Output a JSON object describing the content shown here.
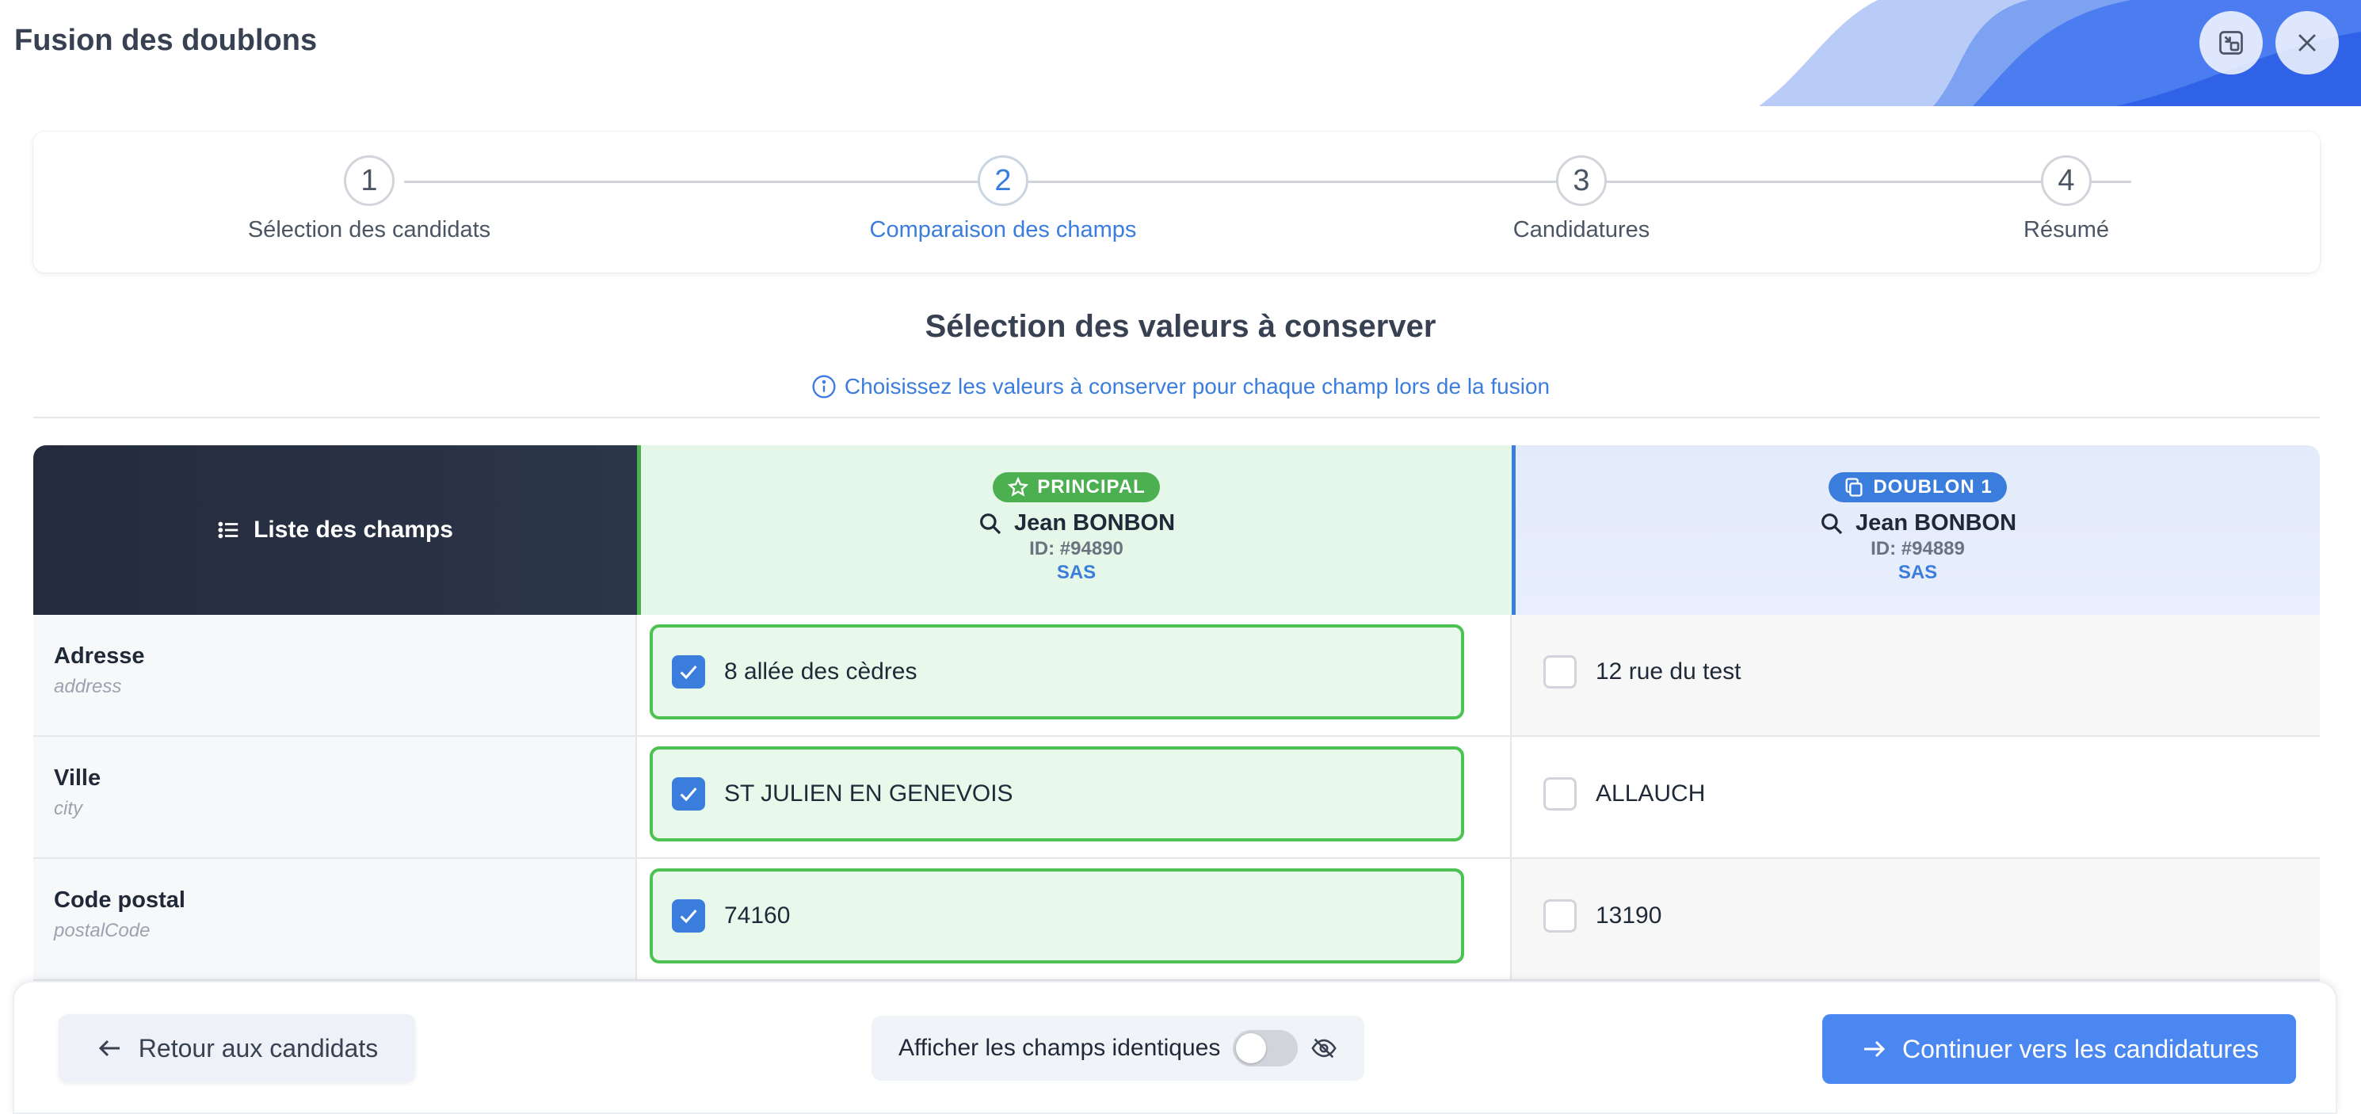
{
  "window": {
    "title": "Fusion des doublons"
  },
  "stepper": {
    "steps": [
      {
        "number": "1",
        "label": "Sélection des candidats"
      },
      {
        "number": "2",
        "label": "Comparaison des champs"
      },
      {
        "number": "3",
        "label": "Candidatures"
      },
      {
        "number": "4",
        "label": "Résumé"
      }
    ],
    "active_step": 2
  },
  "section": {
    "title": "Sélection des valeurs à conserver",
    "hint": "Choisissez les valeurs à conserver pour chaque champ lors de la fusion"
  },
  "table": {
    "fields_header": "Liste des champs",
    "principal": {
      "badge": "PRINCIPAL",
      "name": "Jean BONBON",
      "id": "ID: #94890",
      "company": "SAS"
    },
    "doublon": {
      "badge": "DOUBLON 1",
      "name": "Jean BONBON",
      "id": "ID: #94889",
      "company": "SAS"
    },
    "rows": [
      {
        "label": "Adresse",
        "key": "address",
        "principal_value": "8 allée des cèdres",
        "doublon_value": "12 rue du test",
        "selected": "principal"
      },
      {
        "label": "Ville",
        "key": "city",
        "principal_value": "ST JULIEN EN GENEVOIS",
        "doublon_value": "ALLAUCH",
        "selected": "principal"
      },
      {
        "label": "Code postal",
        "key": "postalCode",
        "principal_value": "74160",
        "doublon_value": "13190",
        "selected": "principal"
      }
    ]
  },
  "footer": {
    "back_label": "Retour aux candidats",
    "toggle_label": "Afficher les champs identiques",
    "toggle_on": false,
    "next_label": "Continuer vers les candidatures"
  },
  "colors": {
    "accent": "#3b7ddd",
    "success": "#4caf50",
    "header_dark": "#232b3c"
  },
  "icons": {
    "minimize": "minimize-window-icon",
    "close": "close-icon",
    "info": "info-icon",
    "list": "list-icon",
    "star": "star-icon",
    "copy": "copy-icon",
    "search": "search-icon",
    "check": "check-icon",
    "arrow_left": "arrow-left-icon",
    "arrow_right": "arrow-right-icon",
    "eye_off": "eye-off-icon"
  }
}
